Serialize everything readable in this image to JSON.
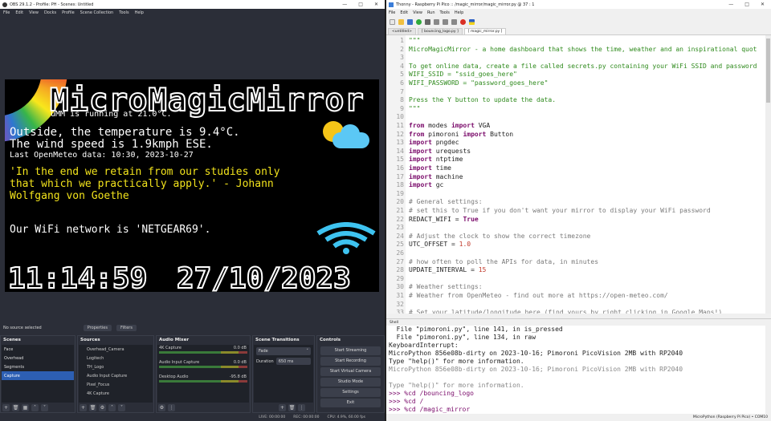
{
  "obs": {
    "title": "OBS 29.1.2 - Profile: PH - Scenes: Untitled",
    "menu": [
      "File",
      "Edit",
      "View",
      "Docks",
      "Profile",
      "Scene Collection",
      "Tools",
      "Help"
    ],
    "preview": {
      "title": "MicroMagicMirror",
      "subtitle": "uMM is running at 21.0°C.",
      "line1": "Outside, the temperature is 9.4°C.",
      "line2": "The wind speed is 1.9kmph ESE.",
      "line3": "Last OpenMeteo data: 10:30, 2023-10-27",
      "quote1": "'In the end we retain from our studies only",
      "quote2": "that which we practically apply.' - Johann",
      "quote3": "Wolfgang von Goethe",
      "wifi": "Our WiFi network is 'NETGEAR69'.",
      "time": "11:14:59",
      "date": "27/10/2023"
    },
    "no_source": "No source selected",
    "properties": "Properties",
    "filters": "Filters",
    "scenes": {
      "title": "Scenes",
      "items": [
        "Face",
        "Overhead",
        "Segments",
        "Capture"
      ]
    },
    "sources": {
      "title": "Sources",
      "items": [
        "Overhead_Camera",
        "Logitech",
        "TH_Logo",
        "Audio Input Capture",
        "Pixel_Focus",
        "4K Capture"
      ]
    },
    "mixer": {
      "title": "Audio Mixer",
      "channels": [
        {
          "name": "4K Capture",
          "db": "0.0 dB"
        },
        {
          "name": "Audio Input Capture",
          "db": "0.0 dB"
        },
        {
          "name": "Desktop Audio",
          "db": "-95.8 dB"
        }
      ]
    },
    "transitions": {
      "title": "Scene Transitions",
      "value": "Fade",
      "duration_label": "Duration",
      "duration": "650 ms"
    },
    "controls": {
      "title": "Controls",
      "buttons": [
        "Start Streaming",
        "Start Recording",
        "Start Virtual Camera",
        "Studio Mode",
        "Settings",
        "Exit"
      ]
    },
    "status": {
      "live": "LIVE: 00:00:00",
      "rec": "REC: 00:00:00",
      "cpu": "CPU: 4.9%, 60.00 fps"
    }
  },
  "thonny": {
    "title": "Thonny - Raspberry Pi Pico :: /magic_mirror/magic_mirror.py @ 37 : 1",
    "menu": [
      "File",
      "Edit",
      "View",
      "Run",
      "Tools",
      "Help"
    ],
    "tabs": [
      "<untitled>",
      "[ bouncing_logo.py ]",
      "[ magic_mirror.py ]"
    ],
    "code": [
      {
        "n": "1",
        "t": "\"\"\"",
        "c": "str"
      },
      {
        "n": "2",
        "t": "MicroMagicMirror - a home dashboard that shows the time, weather and an inspirational quot",
        "c": "str"
      },
      {
        "n": "3",
        "t": "",
        "c": "str"
      },
      {
        "n": "4",
        "t": "To get online data, create a file called secrets.py containing your WiFi SSID and password",
        "c": "str"
      },
      {
        "n": "5",
        "t": "WIFI_SSID = \"ssid_goes_here\"",
        "c": "str"
      },
      {
        "n": "6",
        "t": "WIFI_PASSWORD = \"password_goes_here\"",
        "c": "str"
      },
      {
        "n": "7",
        "t": "",
        "c": "str"
      },
      {
        "n": "8",
        "t": "Press the Y button to update the data.",
        "c": "str"
      },
      {
        "n": "9",
        "t": "\"\"\"",
        "c": "str"
      },
      {
        "n": "10",
        "t": "",
        "c": ""
      },
      {
        "n": "11",
        "t": "from modes import VGA",
        "c": "imp"
      },
      {
        "n": "12",
        "t": "from pimoroni import Button",
        "c": "imp"
      },
      {
        "n": "13",
        "t": "import pngdec",
        "c": "imp"
      },
      {
        "n": "14",
        "t": "import urequests",
        "c": "imp"
      },
      {
        "n": "15",
        "t": "import ntptime",
        "c": "imp"
      },
      {
        "n": "16",
        "t": "import time",
        "c": "imp"
      },
      {
        "n": "17",
        "t": "import machine",
        "c": "imp"
      },
      {
        "n": "18",
        "t": "import gc",
        "c": "imp"
      },
      {
        "n": "19",
        "t": "",
        "c": ""
      },
      {
        "n": "20",
        "t": "# General settings:",
        "c": "cm"
      },
      {
        "n": "21",
        "t": "# set this to True if you don't want your mirror to display your WiFi password",
        "c": "cm"
      },
      {
        "n": "22",
        "t": "REDACT_WIFI = True",
        "c": "assign"
      },
      {
        "n": "23",
        "t": "",
        "c": ""
      },
      {
        "n": "24",
        "t": "# Adjust the clock to show the correct timezone",
        "c": "cm"
      },
      {
        "n": "25",
        "t": "UTC_OFFSET = 1.0",
        "c": "assign"
      },
      {
        "n": "26",
        "t": "",
        "c": ""
      },
      {
        "n": "27",
        "t": "# how often to poll the APIs for data, in minutes",
        "c": "cm"
      },
      {
        "n": "28",
        "t": "UPDATE_INTERVAL = 15",
        "c": "assign"
      },
      {
        "n": "29",
        "t": "",
        "c": ""
      },
      {
        "n": "30",
        "t": "# Weather settings:",
        "c": "cm"
      },
      {
        "n": "31",
        "t": "# Weather from OpenMeteo - find out more at https://open-meteo.com/",
        "c": "cm"
      },
      {
        "n": "32",
        "t": "",
        "c": ""
      },
      {
        "n": "33",
        "t": "# Set your latitude/longitude here (find yours by right clicking in Google Maps!)",
        "c": "cm"
      }
    ],
    "shell_label": "Shell",
    "shell": [
      {
        "t": "  File \"pimoroni.py\", line 141, in is_pressed",
        "c": "sh-err"
      },
      {
        "t": "  File \"pimoroni.py\", line 134, in raw",
        "c": "sh-err"
      },
      {
        "t": "KeyboardInterrupt:",
        "c": "sh-err"
      },
      {
        "t": "MicroPython 856e08b-dirty on 2023-10-16; Pimoroni PicoVision 2MB with RP2040",
        "c": "sh-err"
      },
      {
        "t": "Type \"help()\" for more information.",
        "c": "sh-err"
      },
      {
        "t": "MicroPython 856e08b-dirty on 2023-10-16; Pimoroni PicoVision 2MB with RP2040",
        "c": "sh-gray"
      },
      {
        "t": "",
        "c": "sh-gray"
      },
      {
        "t": "Type \"help()\" for more information.",
        "c": "sh-gray"
      },
      {
        "t": ">>> %cd /bouncing_logo",
        "c": "sh-prompt"
      },
      {
        "t": ">>> %cd /",
        "c": "sh-prompt"
      },
      {
        "t": ">>> %cd /magic_mirror",
        "c": "sh-prompt"
      },
      {
        "t": ">>> ",
        "c": "sh-prompt"
      }
    ],
    "status": "MicroPython (Raspberry Pi Pico) • COM10"
  }
}
